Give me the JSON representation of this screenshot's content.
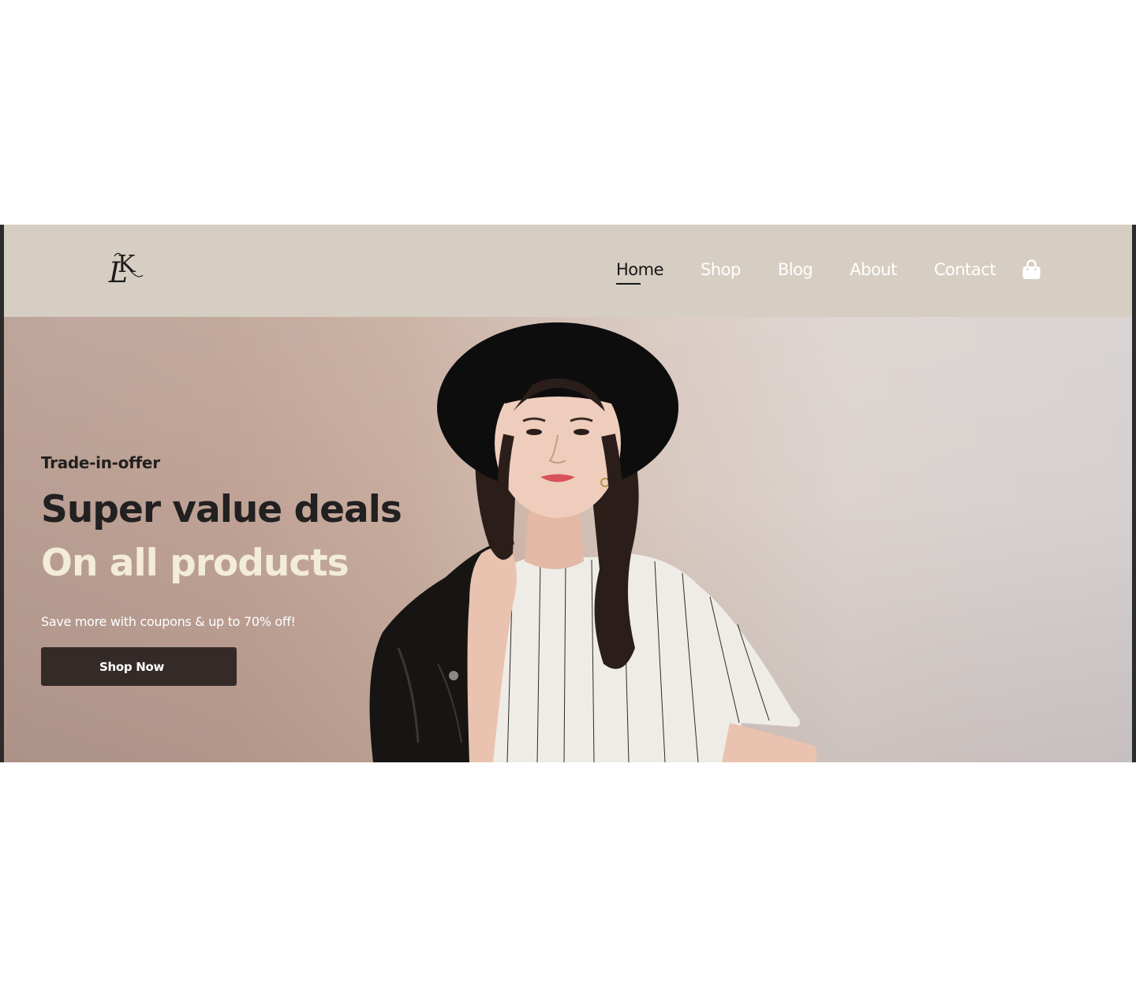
{
  "header": {
    "logo": "LK",
    "nav": [
      {
        "label": "Home",
        "active": true
      },
      {
        "label": "Shop",
        "active": false
      },
      {
        "label": "Blog",
        "active": false
      },
      {
        "label": "About",
        "active": false
      },
      {
        "label": "Contact",
        "active": false
      }
    ],
    "cart_icon": "shopping-bag-icon"
  },
  "hero": {
    "eyebrow": "Trade-in-offer",
    "headline": "Super value deals",
    "subheadline": "On all products",
    "tagline": "Save more with coupons & up to 70% off!",
    "cta_label": "Shop Now",
    "image": "model-photo"
  },
  "colors": {
    "header_bg": "#d6cec2",
    "headline": "#222020",
    "subheadline": "#f3ecd6",
    "button_bg": "#342b29"
  }
}
